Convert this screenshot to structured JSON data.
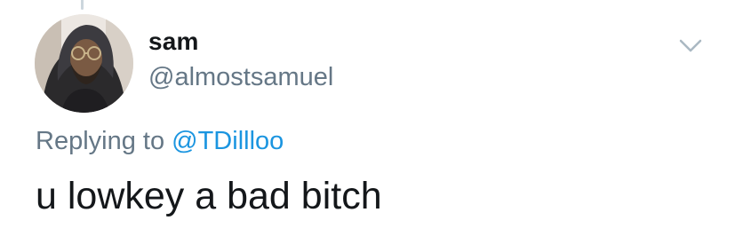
{
  "tweet": {
    "user": {
      "display_name": "sam",
      "handle": "@almostsamuel",
      "avatar_icon": "user-avatar"
    },
    "reply_context": {
      "prefix": "Replying to",
      "mention": "@TDillloo"
    },
    "text": "u lowkey a bad bitch",
    "menu_icon": "chevron-down-icon"
  },
  "colors": {
    "primary_text": "#14171a",
    "secondary_text": "#657786",
    "link": "#1b95e0",
    "divider": "#ccd6dd"
  }
}
